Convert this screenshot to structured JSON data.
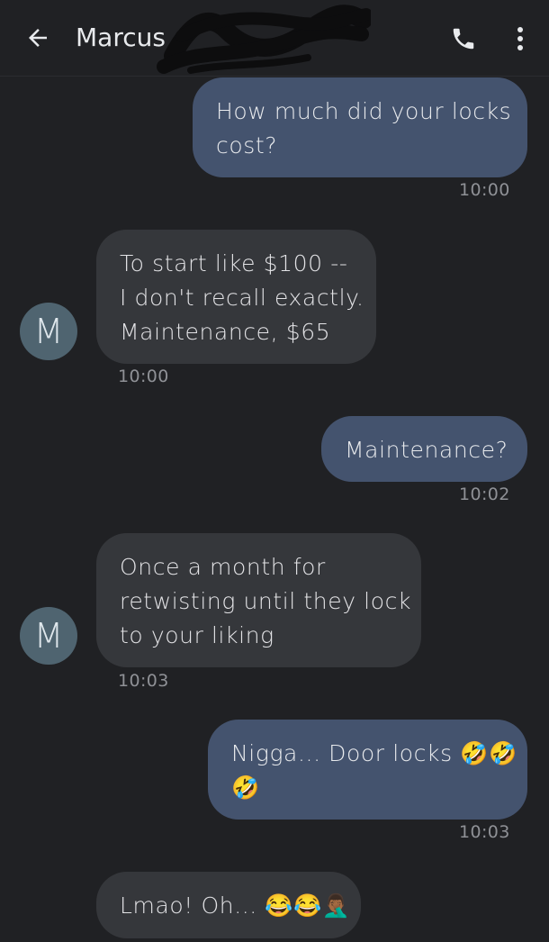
{
  "header": {
    "contact_name": "Marcus",
    "icons": {
      "back": "arrow-back-icon",
      "call": "phone-icon",
      "menu": "more-vert-icon"
    }
  },
  "avatar_letter": "M",
  "messages": [
    {
      "direction": "outgoing",
      "lines": [
        "How much did your locks",
        "cost?"
      ],
      "time": "10:00"
    },
    {
      "direction": "incoming",
      "lines": [
        "To start like $100 --",
        "I don't recall exactly.",
        "Maintenance, $65"
      ],
      "time": "10:00"
    },
    {
      "direction": "outgoing",
      "lines": [
        "Maintenance?"
      ],
      "time": "10:02"
    },
    {
      "direction": "incoming",
      "lines": [
        "Once a month for",
        "retwisting until they lock",
        "to your liking"
      ],
      "time": "10:03"
    },
    {
      "direction": "outgoing",
      "lines": [
        "Nigga... Door locks 🤣🤣",
        "🤣"
      ],
      "time": "10:03"
    },
    {
      "direction": "incoming",
      "lines": [
        "Lmao! Oh... 😂😂🤦🏾‍♂️"
      ],
      "time": ""
    }
  ],
  "colors": {
    "background": "#202124",
    "outgoing_bubble": "#44536e",
    "incoming_bubble": "#35373b",
    "avatar": "#4f6470",
    "timestamp": "#8f9196"
  }
}
